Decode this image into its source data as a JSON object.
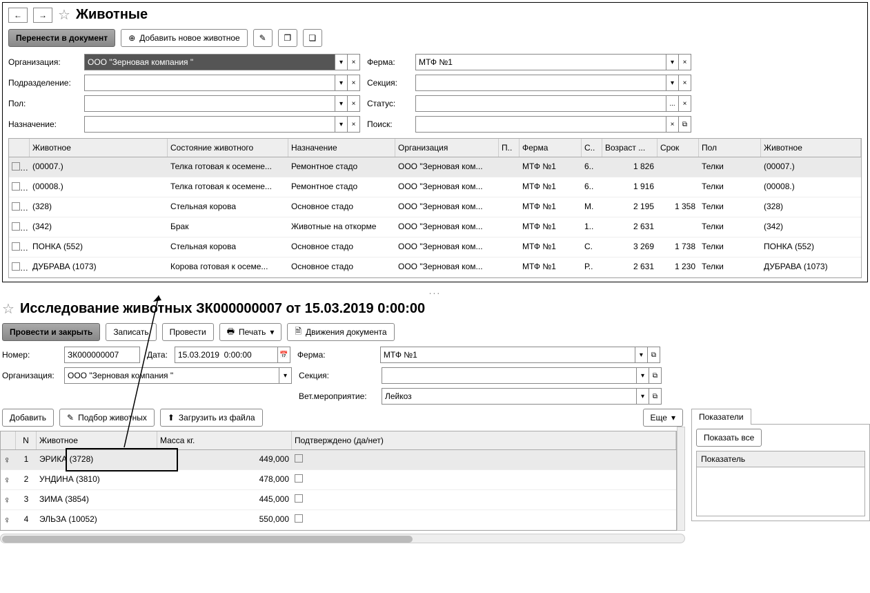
{
  "top": {
    "title": "Животные",
    "buttons": {
      "transfer": "Перенести в документ",
      "add": "Добавить новое животное"
    },
    "filters": {
      "org_label": "Организация:",
      "org_value": "ООО \"Зерновая компания \"",
      "farm_label": "Ферма:",
      "farm_value": "МТФ №1",
      "dept_label": "Подразделение:",
      "section_label": "Секция:",
      "sex_label": "Пол:",
      "status_label": "Статус:",
      "purpose_label": "Назначение:",
      "search_label": "Поиск:"
    },
    "headers": {
      "animal": "Животное",
      "state": "Состояние животного",
      "purpose": "Назначение",
      "org": "Организация",
      "p": "П..",
      "farm": "Ферма",
      "s": "С..",
      "age": "Возраст ...",
      "term": "Срок",
      "sex": "Пол",
      "animal2": "Животное"
    },
    "rows": [
      {
        "animal": "(00007.)",
        "state": "Телка готовая к осемене...",
        "purpose": "Ремонтное стадо",
        "org": "ООО \"Зерновая ком...",
        "farm": "МТФ №1",
        "s": "6..",
        "age": "1 826",
        "term": "",
        "sex": "Телки",
        "animal2": "(00007.)"
      },
      {
        "animal": "(00008.)",
        "state": "Телка готовая к осемене...",
        "purpose": "Ремонтное стадо",
        "org": "ООО \"Зерновая ком...",
        "farm": "МТФ №1",
        "s": "6..",
        "age": "1 916",
        "term": "",
        "sex": "Телки",
        "animal2": "(00008.)"
      },
      {
        "animal": "(328)",
        "state": "Стельная корова",
        "purpose": "Основное стадо",
        "org": "ООО \"Зерновая ком...",
        "farm": "МТФ №1",
        "s": "М.",
        "age": "2 195",
        "term": "1 358",
        "sex": "Телки",
        "animal2": "(328)"
      },
      {
        "animal": "(342)",
        "state": "Брак",
        "purpose": "Животные на откорме",
        "org": "ООО \"Зерновая ком...",
        "farm": "МТФ №1",
        "s": "1..",
        "age": "2 631",
        "term": "",
        "sex": "Телки",
        "animal2": "(342)"
      },
      {
        "animal": "ПОНКА (552)",
        "state": "Стельная корова",
        "purpose": "Основное стадо",
        "org": "ООО \"Зерновая ком...",
        "farm": "МТФ №1",
        "s": "С.",
        "age": "3 269",
        "term": "1 738",
        "sex": "Телки",
        "animal2": "ПОНКА (552)"
      },
      {
        "animal": "ДУБРАВА (1073)",
        "state": "Корова готовая к осеме...",
        "purpose": "Основное стадо",
        "org": "ООО \"Зерновая ком...",
        "farm": "МТФ №1",
        "s": "Р..",
        "age": "2 631",
        "term": "1 230",
        "sex": "Телки",
        "animal2": "ДУБРАВА (1073)"
      }
    ]
  },
  "dots": "...",
  "bottom": {
    "title": "Исследование животных ЗК000000007 от 15.03.2019 0:00:00",
    "buttons": {
      "post_close": "Провести и закрыть",
      "save": "Записать",
      "post": "Провести",
      "print": "Печать",
      "movements": "Движения документа",
      "add": "Добавить",
      "pick": "Подбор животных",
      "load": "Загрузить из файла",
      "more": "Еще"
    },
    "fields": {
      "num_label": "Номер:",
      "num_value": "ЗК000000007",
      "date_label": "Дата:",
      "date_value": "15.03.2019  0:00:00",
      "farm_label": "Ферма:",
      "farm_value": "МТФ №1",
      "org_label": "Организация:",
      "org_value": "ООО \"Зерновая компания \"",
      "section_label": "Секция:",
      "event_label": "Вет.мероприятие:",
      "event_value": "Лейкоз"
    },
    "headers": {
      "n": "N",
      "animal": "Животное",
      "mass": "Масса кг.",
      "conf": "Подтверждено (да/нет)"
    },
    "rows": [
      {
        "n": "1",
        "animal": "ЭРИКА (3728)",
        "mass": "449,000"
      },
      {
        "n": "2",
        "animal": "УНДИНА (3810)",
        "mass": "478,000"
      },
      {
        "n": "3",
        "animal": "ЗИМА (3854)",
        "mass": "445,000"
      },
      {
        "n": "4",
        "animal": "ЭЛЬЗА (10052)",
        "mass": "550,000"
      }
    ],
    "right": {
      "tab": "Показатели",
      "show_all": "Показать все",
      "header": "Показатель"
    }
  }
}
